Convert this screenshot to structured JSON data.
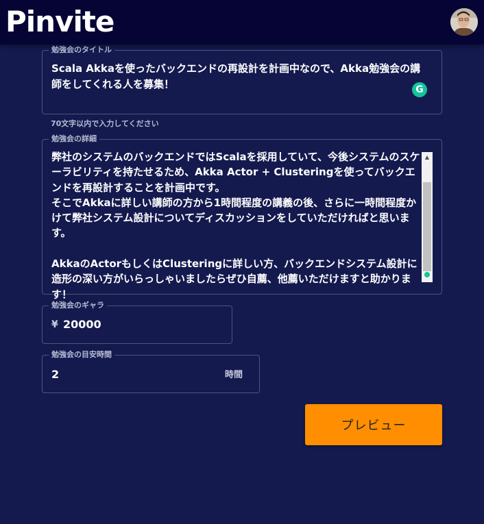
{
  "header": {
    "logo_text": "Pinvite",
    "avatar_icon": "user-avatar"
  },
  "form": {
    "title": {
      "label": "勉強会のタイトル",
      "value": "Scala Akkaを使ったバックエンドの再設計を計画中なので、Akka勉強会の講師をしてくれる人を募集！",
      "helper": "70文字以内で入力してください",
      "badge_icon": "grammarly-icon",
      "badge_text": "G"
    },
    "detail": {
      "label": "勉強会の詳細",
      "value": "弊社のシステムのバックエンドではScalaを採用していて、今後システムのスケーラビリティを持たせるため、Akka Actor + Clusteringを使ってバックエンドを再設計することを計画中です。\nそこでAkkaに詳しい講師の方から1時間程度の講義の後、さらに一時間程度かけて弊社システム設計についてディスカッションをしていただければと思います。\n\nAkkaのActorもしくはClusteringに詳しい方、バックエンドシステム設計に造形の深い方がいらっしゃいましたらぜひ自薦、他薦いただけますと助かります！",
      "scroll_up_glyph": "▲"
    },
    "fee": {
      "label": "勉強会のギャラ",
      "currency": "¥",
      "value": "20000"
    },
    "hours": {
      "label": "勉強会の目安時間",
      "value": "2",
      "unit": "時間"
    },
    "preview_label": "プレビュー"
  },
  "colors": {
    "header_bg": "#050434",
    "page_bg": "#141a4e",
    "accent": "#ff8f00",
    "grammarly": "#15c39a"
  }
}
